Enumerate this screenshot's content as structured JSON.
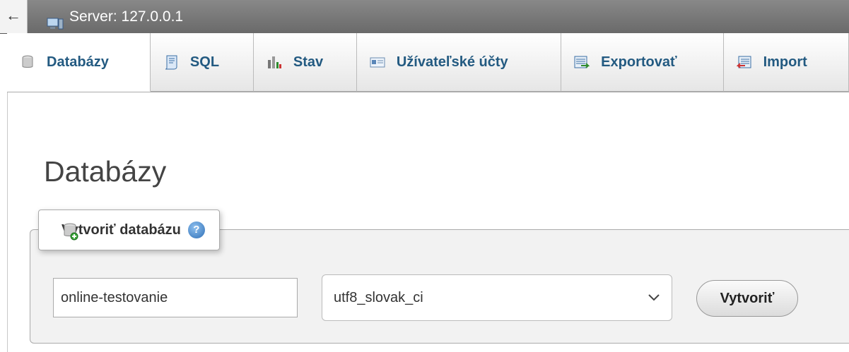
{
  "topbar": {
    "back_icon": "←",
    "server_label": "Server: 127.0.0.1"
  },
  "tabs": [
    {
      "label": "Databázy",
      "icon": "database-icon",
      "active": true
    },
    {
      "label": "SQL",
      "icon": "sql-icon"
    },
    {
      "label": "Stav",
      "icon": "status-chart-icon"
    },
    {
      "label": "Užívateľské účty",
      "icon": "user-accounts-icon"
    },
    {
      "label": "Exportovať",
      "icon": "export-icon"
    },
    {
      "label": "Import",
      "icon": "import-icon"
    }
  ],
  "main": {
    "title": "Databázy",
    "create": {
      "legend": "Vytvoriť databázu",
      "db_name_value": "online-testovanie",
      "collation_value": "utf8_slovak_ci",
      "submit_label": "Vytvoriť"
    }
  },
  "colors": {
    "link": "#235a81",
    "topbar": "#6a6a6a",
    "fieldset_bg": "#f2f2f2"
  }
}
